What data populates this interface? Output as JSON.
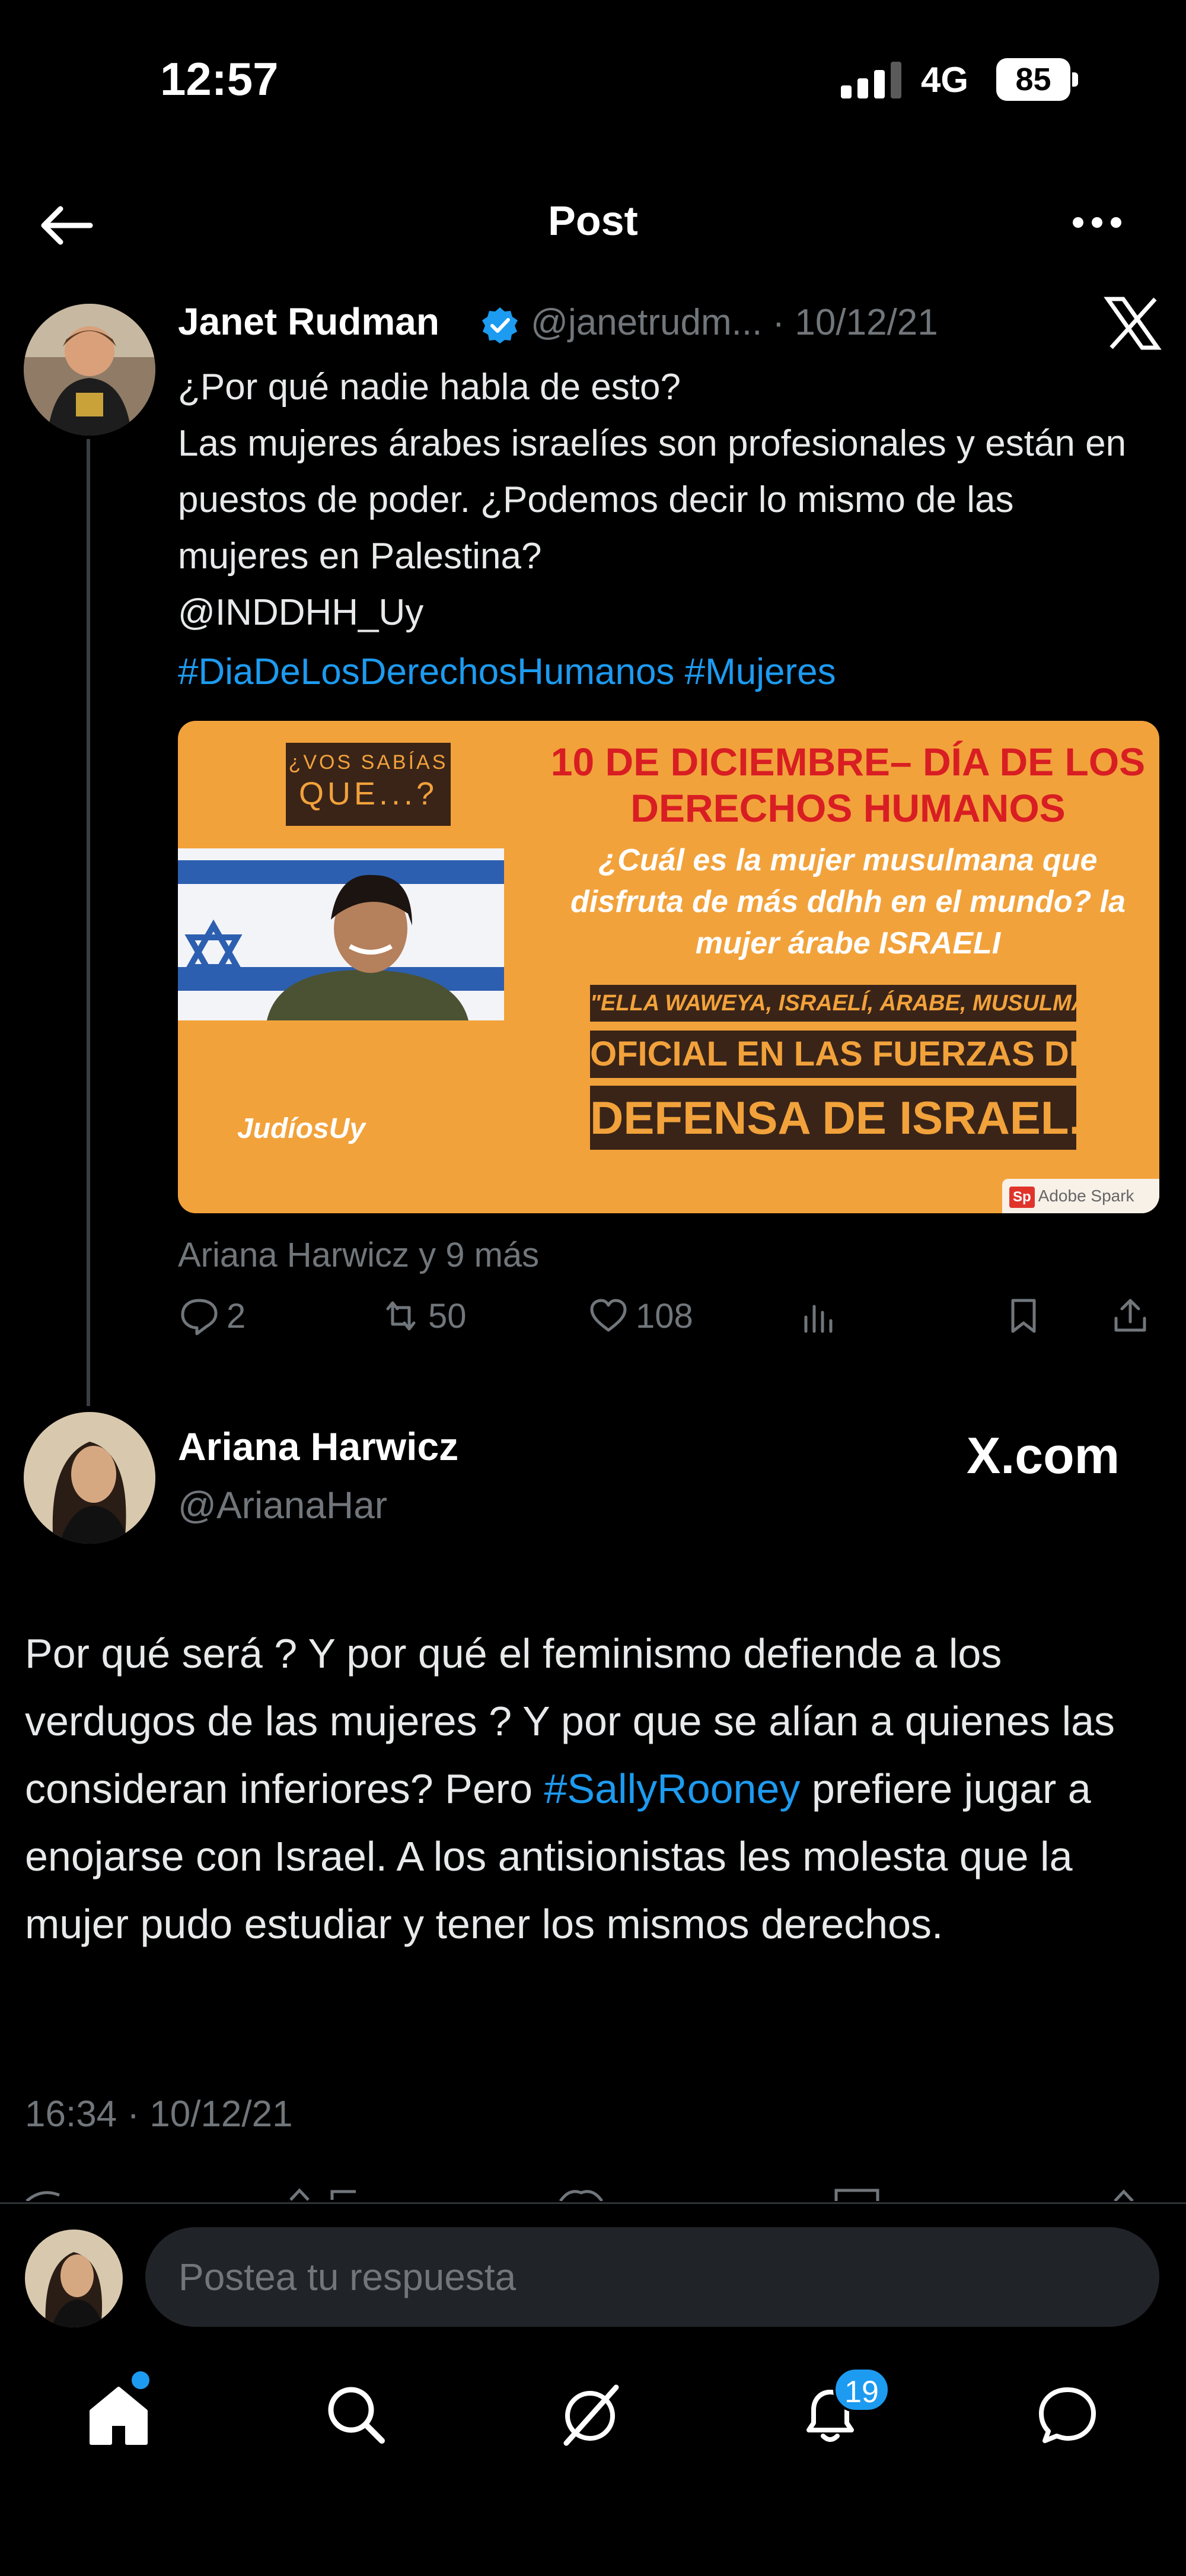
{
  "status_bar": {
    "time": "12:57",
    "network": "4G",
    "battery": "85"
  },
  "header": {
    "title": "Post"
  },
  "tweet1": {
    "author_name": "Janet Rudman",
    "handle_date": "@janetrudm... · 10/12/21",
    "text": "¿Por qué nadie habla de esto?\nLas mujeres árabes israelíes son profesionales y están en puestos de poder. ¿Podemos decir lo mismo de las mujeres en Palestina?\n@INDDHH_Uy",
    "hashtags": "#DiaDeLosDerechosHumanos #Mujeres",
    "card": {
      "vos_line1": "¿VOS SABÍAS",
      "vos_line2": "QUE...?",
      "heading": "10 DE DICIEMBRE– DÍA DE LOS DERECHOS HUMANOS",
      "question": "¿Cuál es la mujer musulmana que disfruta de más ddhh en el mundo? la mujer árabe ISRAELI",
      "quote": "\"ELLA WAWEYA, ISRAELÍ, ÁRABE, MUSULMANA,",
      "line_oficial": "OFICIAL EN LAS FUERZAS DE",
      "line_defensa": "DEFENSA DE ISRAEL.",
      "brand": "JudíosUy",
      "spark_badge": "Sp",
      "spark_label": "Adobe Spark"
    },
    "liked_by": "Ariana Harwicz y 9 más",
    "stats": {
      "replies": "2",
      "retweets": "50",
      "likes": "108"
    }
  },
  "tweet2": {
    "author_name": "Ariana Harwicz",
    "handle": "@ArianaHar",
    "source": "X.com",
    "text_before": "Por qué será ? Y por qué el feminismo defiende a los verdugos de las mujeres ? Y por que se alían a quienes las consideran inferiores? Pero ",
    "hashtag": "#SallyRooney",
    "text_after": " prefiere jugar a enojarse con Israel. A los antisionistas les molesta que la mujer pudo estudiar y tener los mismos derechos.",
    "timestamp": "16:34 · 10/12/21"
  },
  "reply_bar": {
    "placeholder": "Postea tu respuesta"
  },
  "nav": {
    "notifications_count": "19"
  },
  "colors": {
    "accent": "#1d9bf0",
    "card_bg": "#f2a23b",
    "card_heading": "#d81e23"
  }
}
